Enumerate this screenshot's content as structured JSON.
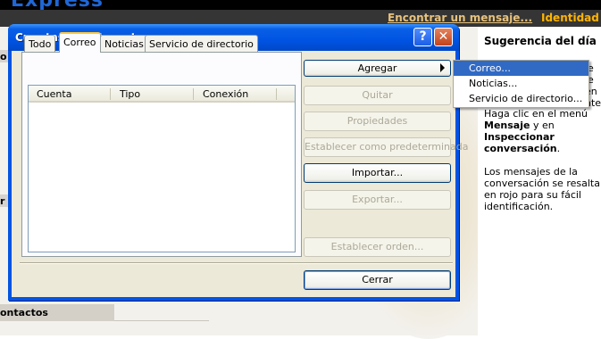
{
  "background_app": {
    "brand": "Express",
    "find_message_link": "Encontrar un mensaje...",
    "identities_link": "Identidad",
    "left_fragment_1": "o",
    "left_fragment_2": "r",
    "contacts_label": "ontactos",
    "tip": {
      "title": "Sugerencia del día",
      "peek_text": "ie\nle\nen\nnte",
      "paragraph1_pre": "Haga clic en el menú ",
      "paragraph1_b1": "Mensaje",
      "paragraph1_mid": " y en ",
      "paragraph1_b2": "Inspeccionar conversación",
      "paragraph1_post": ".",
      "paragraph2": "Los mensajes de la conversación se resalta en rojo para su fácil identificación."
    }
  },
  "dialog": {
    "title": "Cuentas de Internet",
    "help_glyph": "?",
    "close_glyph": "✕",
    "tabs": [
      {
        "label": "Todo",
        "active": false
      },
      {
        "label": "Correo",
        "active": true
      },
      {
        "label": "Noticias",
        "active": false
      },
      {
        "label": "Servicio de directorio",
        "active": false
      }
    ],
    "list_columns": [
      "Cuenta",
      "Tipo",
      "Conexión"
    ],
    "buttons": {
      "agregar": "Agregar",
      "quitar": "Quitar",
      "propiedades": "Propiedades",
      "predeterminada": "Establecer como predeterminada",
      "importar": "Importar...",
      "exportar": "Exportar...",
      "orden": "Establecer orden...",
      "cerrar": "Cerrar"
    },
    "agregar_menu": [
      {
        "label": "Correo...",
        "selected": true
      },
      {
        "label": "Noticias...",
        "selected": false
      },
      {
        "label": "Servicio de directorio...",
        "selected": false
      }
    ]
  },
  "colors": {
    "titlebar": "#0054e3",
    "menu_highlight": "#316ac5",
    "tab_highlight": "#ffc83c",
    "link_orange": "#ffb400"
  }
}
